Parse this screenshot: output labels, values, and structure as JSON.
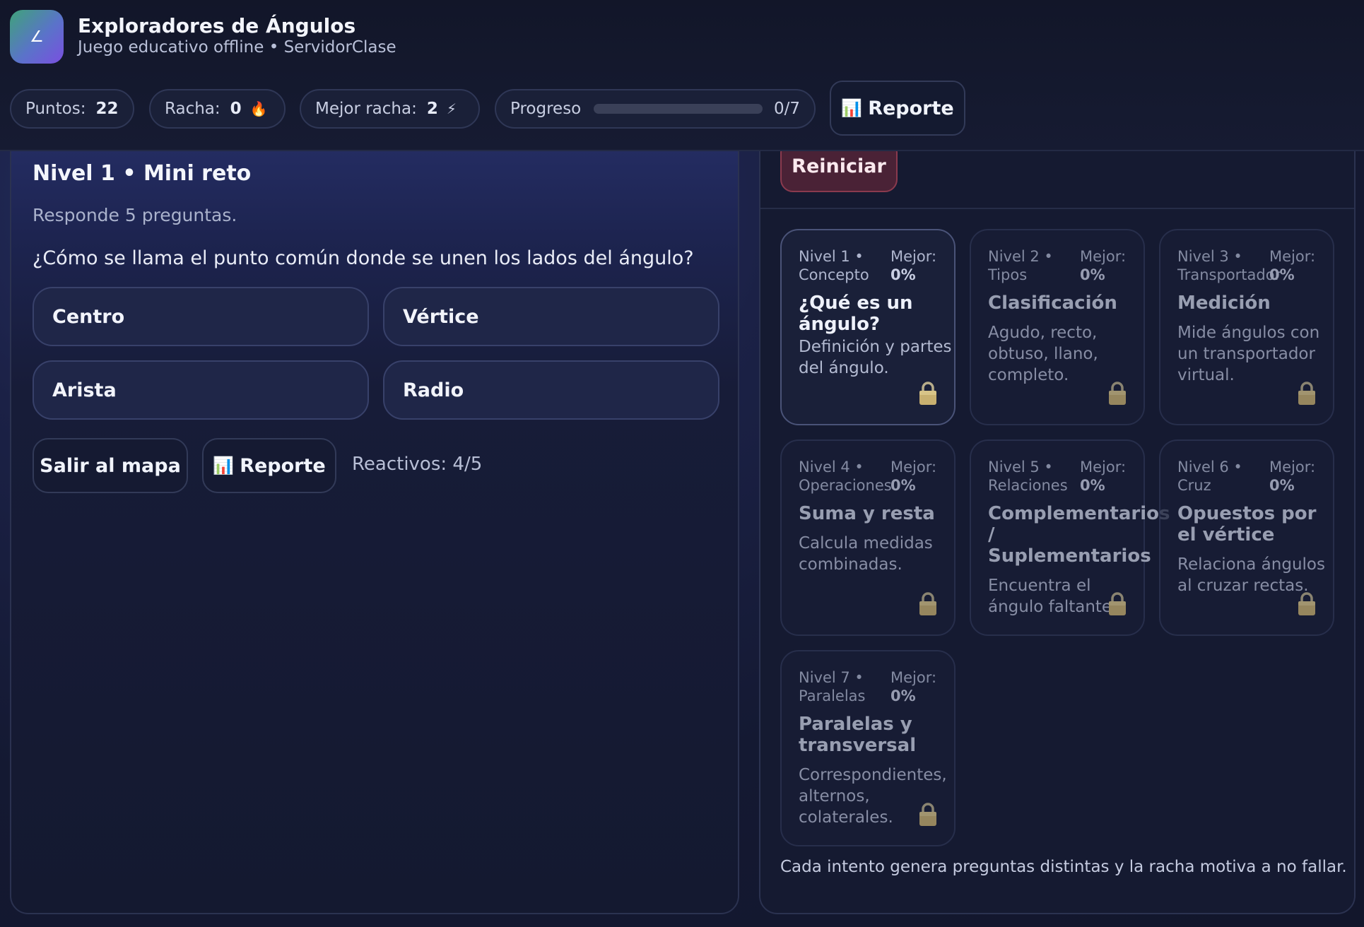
{
  "app": {
    "title": "Exploradores de Ángulos",
    "subtitle": "Juego educativo offline • ServidorClase",
    "logo_glyph": "∠"
  },
  "stats": {
    "points_label": "Puntos:",
    "points_value": "22",
    "streak_label": "Racha:",
    "streak_value": "0",
    "streak_icon": "🔥",
    "best_label": "Mejor racha:",
    "best_value": "2",
    "best_icon": "⚡",
    "progress_label": "Progreso",
    "progress_count": "0/7",
    "progress_fraction": 0
  },
  "header": {
    "report_icon": "📊",
    "report_label": "Reporte"
  },
  "quiz": {
    "level_title": "Nivel 1 • Mini reto",
    "instructions": "Responde 5 preguntas.",
    "question": "¿Cómo se llama el punto común donde se unen los lados del ángulo?",
    "answers": [
      "Centro",
      "Vértice",
      "Arista",
      "Radio"
    ],
    "exit_label": "Salir al mapa",
    "report_icon": "📊",
    "report_label": "Reporte",
    "items_count": "Reactivos: 4/5"
  },
  "levels_panel": {
    "reset_label": "Reiniciar",
    "best_label": "Mejor:",
    "levels": [
      {
        "meta": "Nivel 1 • Concepto",
        "best": "0%",
        "title": "¿Qué es un ángulo?",
        "desc": "Definición y partes del ángulo."
      },
      {
        "meta": "Nivel 2 • Tipos",
        "best": "0%",
        "title": "Clasificación",
        "desc": "Agudo, recto, obtuso, llano, completo."
      },
      {
        "meta": "Nivel 3 • Transportador",
        "best": "0%",
        "title": "Medición",
        "desc": "Mide ángulos con un transportador virtual."
      },
      {
        "meta": "Nivel 4 • Operaciones",
        "best": "0%",
        "title": "Suma y resta",
        "desc": "Calcula medidas combinadas."
      },
      {
        "meta": "Nivel 5 • Relaciones",
        "best": "0%",
        "title": "Complementarios / Suplementarios",
        "desc": "Encuentra el ángulo faltante."
      },
      {
        "meta": "Nivel 6 • Cruz",
        "best": "0%",
        "title": "Opuestos por el vértice",
        "desc": "Relaciona ángulos al cruzar rectas."
      },
      {
        "meta": "Nivel 7 • Paralelas",
        "best": "0%",
        "title": "Paralelas y transversal",
        "desc": "Correspondientes, alternos, colaterales."
      }
    ],
    "footer_note": "Cada intento genera preguntas distintas y la racha motiva a no fallar."
  },
  "colors": {
    "accent_green": "#3fa37a",
    "accent_purple": "#7a4fe0",
    "danger": "#8a3a4e",
    "lock_gold": "#c8b070"
  }
}
